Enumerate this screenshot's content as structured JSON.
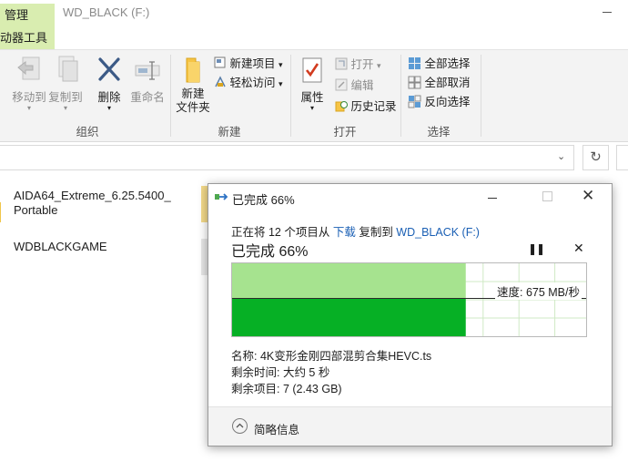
{
  "titlebar": {
    "tab_manage": "管理",
    "title": "WD_BLACK (F:)"
  },
  "tabrow": {
    "tab_drive_tools": "动器工具"
  },
  "ribbon": {
    "move_to": "移动到",
    "copy_to": "复制到",
    "delete": "删除",
    "rename": "重命名",
    "group_organize": "组织",
    "new_folder_line1": "新建",
    "new_folder_line2": "文件夹",
    "new_item": "新建项目",
    "easy_access": "轻松访问",
    "group_new": "新建",
    "properties": "属性",
    "open": "打开",
    "edit": "编辑",
    "history": "历史记录",
    "group_open": "打开",
    "select_all": "全部选择",
    "select_none": "全部取消",
    "invert_selection": "反向选择",
    "group_select": "选择"
  },
  "addressbar": {
    "refresh_glyph": "↻"
  },
  "files": [
    {
      "name_line1": "AIDA64_Extreme_6.25.5400_",
      "name_line2": "Portable"
    },
    {
      "name_line1": "WDBLACKGAME",
      "name_line2": ""
    }
  ],
  "dialog": {
    "title": "已完成 66%",
    "copy_prefix": "正在将 12 个项目从 ",
    "source": "下载",
    "copy_middle": " 复制到 ",
    "destination": "WD_BLACK (F:)",
    "status": "已完成 66%",
    "progress": 0.66,
    "speed": "速度: 675 MB/秒",
    "name_label": "名称: ",
    "name_value": "4K变形金刚四部混剪合集HEVC.ts",
    "time_label": "剩余时间: ",
    "time_value": "大约 5 秒",
    "items_label": "剩余项目: ",
    "items_value": "7 (2.43 GB)",
    "less_details": "简略信息",
    "colors": {
      "fill_light": "#a6e38f",
      "fill_dark": "#06b025",
      "link": "#1a5fb4"
    }
  }
}
